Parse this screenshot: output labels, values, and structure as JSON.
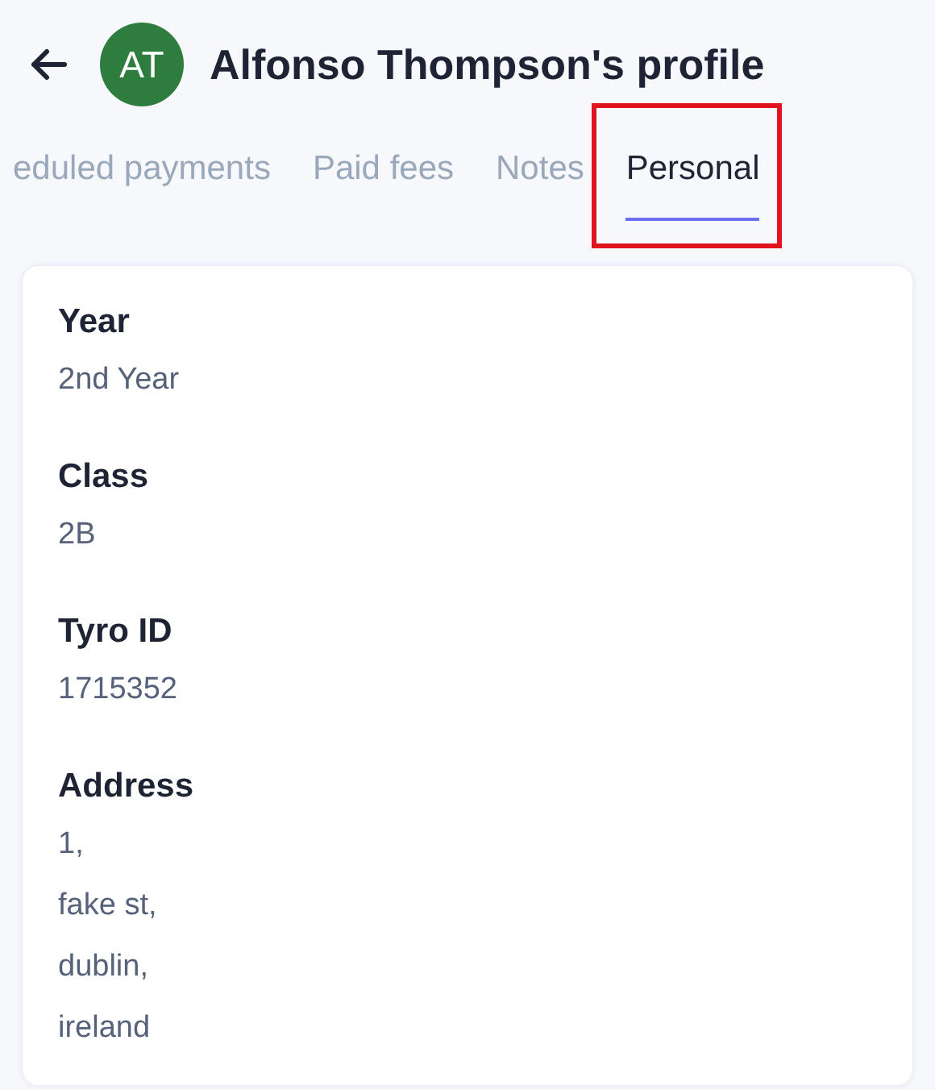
{
  "header": {
    "title": "Alfonso Thompson's profile",
    "avatar": {
      "initials": "AT",
      "color": "#2e7d3e"
    }
  },
  "tabs": [
    {
      "label": "eduled payments",
      "selected": false,
      "highlighted": false
    },
    {
      "label": "Paid fees",
      "selected": false,
      "highlighted": false
    },
    {
      "label": "Notes",
      "selected": false,
      "highlighted": false
    },
    {
      "label": "Personal",
      "selected": true,
      "highlighted": true
    }
  ],
  "fields": [
    {
      "label": "Year",
      "lines": [
        "2nd Year"
      ]
    },
    {
      "label": "Class",
      "lines": [
        "2B"
      ]
    },
    {
      "label": "Tyro ID",
      "lines": [
        "1715352"
      ]
    },
    {
      "label": "Address",
      "lines": [
        "1,",
        "fake st,",
        "dublin,",
        "ireland"
      ]
    }
  ]
}
